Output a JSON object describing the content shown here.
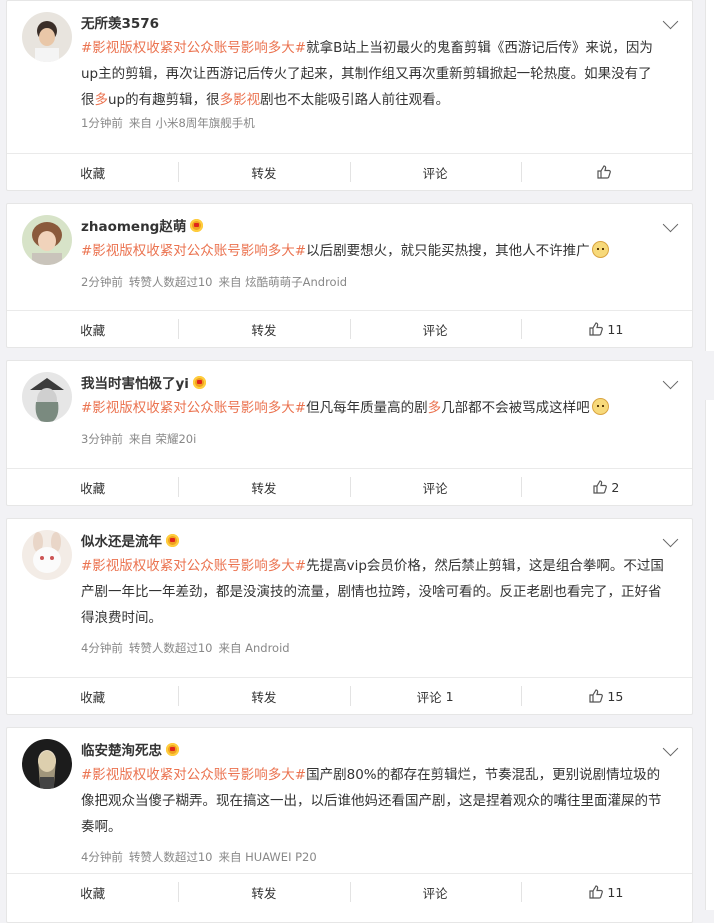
{
  "topic": "#影视版权收紧对公众账号影响多大#",
  "actions": {
    "favorite": "收藏",
    "repost": "转发",
    "comment": "评论"
  },
  "posts": [
    {
      "username": "无所羡3576",
      "vip": false,
      "segments": [
        "就拿B站上当初最火的鬼畜剪辑《西游记后传》来说，因为up主的剪辑，再次让西游记后传火了起来，其制作组又再次重新剪辑掀起一轮热度。如果没有了很",
        "多",
        "up的有趣剪辑，很",
        "多影视",
        "剧也不太能吸引路人前往观看。"
      ],
      "time": "1分钟前",
      "reposted": "",
      "source": "来自 小米8周年旗舰手机",
      "comment_count": "",
      "like_count": ""
    },
    {
      "username": "zhaomeng赵萌",
      "vip": true,
      "segments": [
        "以后剧要想火，就只能买热搜，其他人不许推广"
      ],
      "time": "2分钟前",
      "reposted": "转赞人数超过10",
      "source": "来自 炫酷萌萌子Android",
      "comment_count": "",
      "like_count": "11"
    },
    {
      "username": "我当时害怕极了yi",
      "vip": true,
      "segments": [
        "但凡每年质量高的剧",
        "多",
        "几部都不会被骂成这样吧"
      ],
      "time": "3分钟前",
      "reposted": "",
      "source": "来自 荣耀20i",
      "comment_count": "",
      "like_count": "2"
    },
    {
      "username": "似水还是流年",
      "vip": true,
      "segments": [
        "先提高vip会员价格，然后禁止剪辑，这是组合拳啊。不过国产剧一年比一年差劲，都是没演技的流量，剧情也拉跨，没啥可看的。反正老剧也看完了，正好省得浪费时间。"
      ],
      "time": "4分钟前",
      "reposted": "转赞人数超过10",
      "source": "来自 Android",
      "comment_count": "1",
      "like_count": "15"
    },
    {
      "username": "临安楚洵死忠",
      "vip": true,
      "segments": [
        "国产剧80%的都存在剪辑烂，节奏混乱，更别说剧情垃圾的像把观众当傻子糊弄。现在搞这一出，以后谁他妈还看国产剧，这是捏着观众的嘴往里面灌屎的节奏啊。"
      ],
      "time": "4分钟前",
      "reposted": "转赞人数超过10",
      "source": "来自 HUAWEI P20",
      "comment_count": "",
      "like_count": "11"
    }
  ]
}
